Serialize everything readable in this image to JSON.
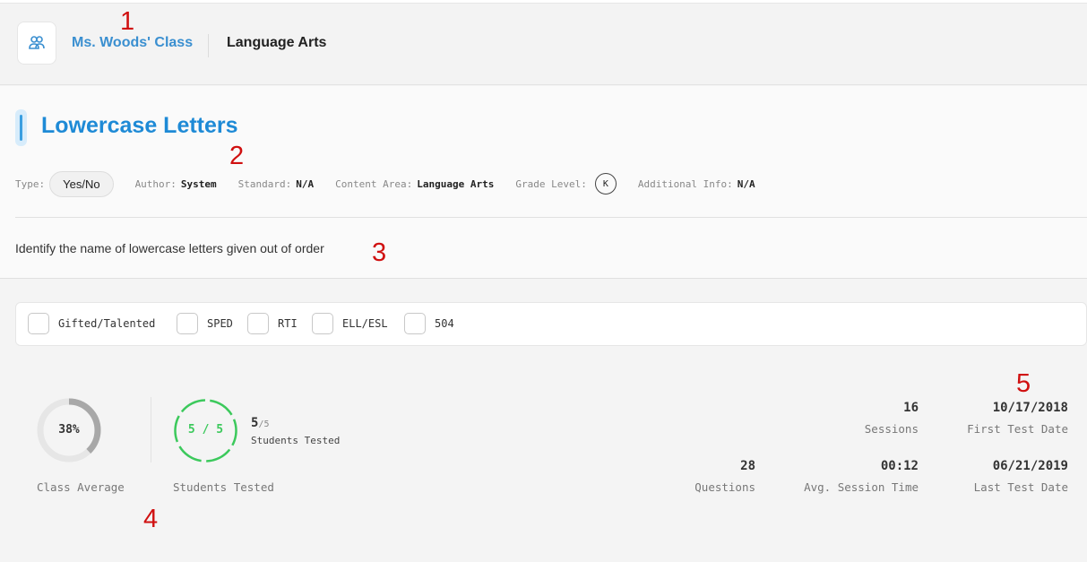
{
  "annotations": [
    "1",
    "2",
    "3",
    "4",
    "5"
  ],
  "header": {
    "class_icon": "people-icon",
    "class_name": "Ms. Woods' Class",
    "subject": "Language Arts"
  },
  "assessment": {
    "title": "Lowercase Letters",
    "meta": {
      "type_label": "Type:",
      "type_value": "Yes/No",
      "author_label": "Author:",
      "author_value": "System",
      "standard_label": "Standard:",
      "standard_value": "N/A",
      "content_area_label": "Content Area:",
      "content_area_value": "Language Arts",
      "grade_level_label": "Grade Level:",
      "grade_level_value": "K",
      "additional_info_label": "Additional Info:",
      "additional_info_value": "N/A"
    },
    "description": "Identify the name of lowercase letters given out of order"
  },
  "filters": [
    {
      "label": "Gifted/Talented",
      "checked": false
    },
    {
      "label": "SPED",
      "checked": false
    },
    {
      "label": "RTI",
      "checked": false
    },
    {
      "label": "ELL/ESL",
      "checked": false
    },
    {
      "label": "504",
      "checked": false
    }
  ],
  "stats": {
    "class_average": {
      "value": "38%",
      "percent": 38,
      "label": "Class Average"
    },
    "students_tested": {
      "ring_text": "5 / 5",
      "count": "5",
      "total": "/5",
      "caption": "Students Tested",
      "label": "Students Tested"
    },
    "sessions": {
      "value": "16",
      "label": "Sessions"
    },
    "first_test_date": {
      "value": "10/17/2018",
      "label": "First Test Date"
    },
    "questions": {
      "value": "28",
      "label": "Questions"
    },
    "avg_session_time": {
      "value": "00:12",
      "label": "Avg. Session Time"
    },
    "last_test_date": {
      "value": "06/21/2019",
      "label": "Last Test Date"
    }
  },
  "colors": {
    "accent": "#1e8ad6",
    "progress_gray": "#a8a8a8",
    "success_green": "#3cc95c",
    "annotation_red": "#d01010"
  }
}
